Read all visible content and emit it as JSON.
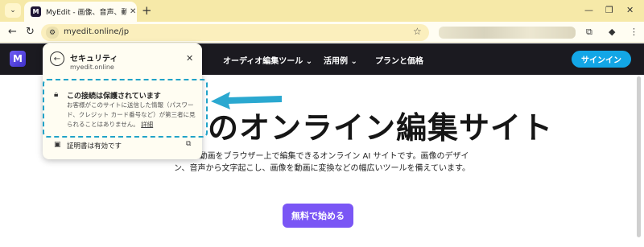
{
  "browser": {
    "tab_menu": "⌄",
    "tab_title": "MyEdit - 画像、音声、動画のオン",
    "favicon": "M",
    "tab_close": "✕",
    "new_tab": "+",
    "url": "myedit.online/jp"
  },
  "site": {
    "logo": "M",
    "nav": [
      "オーディオ編集ツール",
      "活用例",
      "プランと価格"
    ],
    "signin": "サインイン",
    "hero_title": "のオンライン編集サイト",
    "hero_desc": "音声、動画をブラウザー上で編集できるオンライン AI サイトです。画像のデザイン、音声から文字起こし、画像を動画に変換などの幅広いツールを備えています。",
    "cta": "無料で始める"
  },
  "popup": {
    "title": "セキュリティ",
    "domain": "myedit.online",
    "conn_title": "この接続は保護されています",
    "conn_desc": "お客様がこのサイトに送信した情報（パスワード、クレジット カード番号など）が第三者に見られることはありません。",
    "conn_link": "詳細",
    "cert_label": "証明書は有効です"
  },
  "colors": {
    "accent_dashed": "#21a3c8",
    "signin_bg": "#13a6e6",
    "cta_bg": "#7a56f5",
    "header_bg": "#1b1a20"
  }
}
